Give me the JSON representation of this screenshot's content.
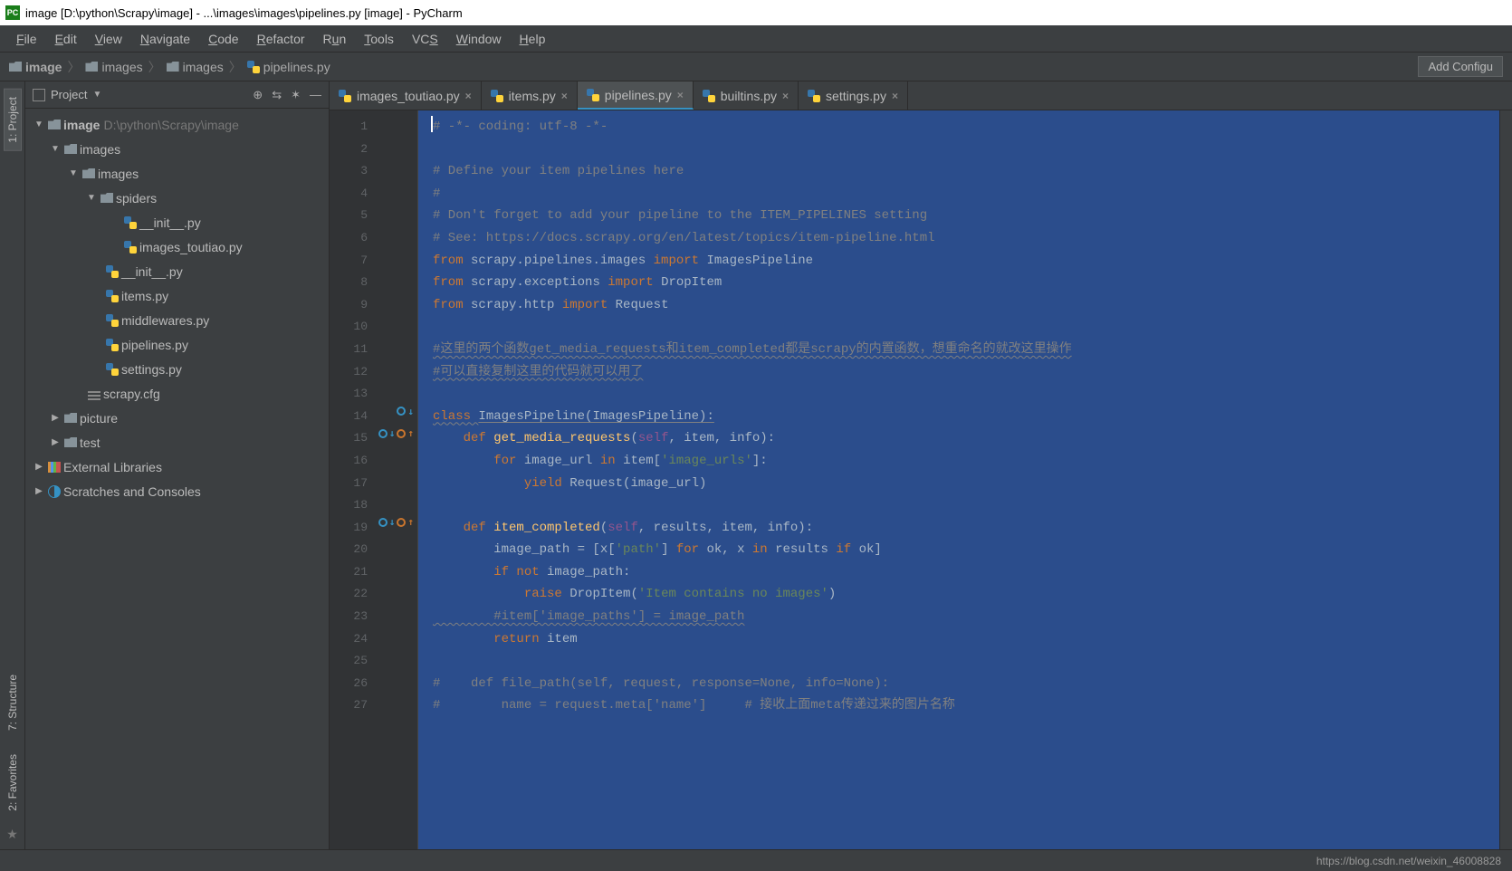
{
  "titlebar": {
    "text": "image [D:\\python\\Scrapy\\image] - ...\\images\\images\\pipelines.py [image] - PyCharm"
  },
  "menu": [
    "File",
    "Edit",
    "View",
    "Navigate",
    "Code",
    "Refactor",
    "Run",
    "Tools",
    "VCS",
    "Window",
    "Help"
  ],
  "breadcrumb": {
    "items": [
      "image",
      "images",
      "images",
      "pipelines.py"
    ]
  },
  "toolbar": {
    "add_config": "Add Configu"
  },
  "left_tabs": {
    "project": "1: Project",
    "structure": "7: Structure",
    "favorites": "2: Favorites"
  },
  "project_header": {
    "title": "Project"
  },
  "tree": {
    "root": {
      "name": "image",
      "path": "D:\\python\\Scrapy\\image"
    },
    "images1": "images",
    "images2": "images",
    "spiders": "spiders",
    "spiders_init": "__init__.py",
    "spiders_toutiao": "images_toutiao.py",
    "init": "__init__.py",
    "items": "items.py",
    "middlewares": "middlewares.py",
    "pipelines": "pipelines.py",
    "settings": "settings.py",
    "scrapycfg": "scrapy.cfg",
    "picture": "picture",
    "test": "test",
    "external": "External Libraries",
    "scratches": "Scratches and Consoles"
  },
  "tabs": [
    {
      "label": "images_toutiao.py",
      "active": false
    },
    {
      "label": "items.py",
      "active": false
    },
    {
      "label": "pipelines.py",
      "active": true
    },
    {
      "label": "builtins.py",
      "active": false
    },
    {
      "label": "settings.py",
      "active": false
    }
  ],
  "code": {
    "l1": "# -*- coding: utf-8 -*-",
    "l2": "",
    "l3": "# Define your item pipelines here",
    "l4": "#",
    "l5": "# Don't forget to add your pipeline to the ITEM_PIPELINES setting",
    "l6": "# See: https://docs.scrapy.org/en/latest/topics/item-pipeline.html",
    "l7a": "from ",
    "l7b": "scrapy.pipelines.images ",
    "l7c": "import ",
    "l7d": "ImagesPipeline",
    "l8a": "from ",
    "l8b": "scrapy.exceptions ",
    "l8c": "import ",
    "l8d": "DropItem",
    "l9a": "from ",
    "l9b": "scrapy.http ",
    "l9c": "import ",
    "l9d": "Request",
    "l11": "#这里的两个函数get_media_requests和item_completed都是scrapy的内置函数，想重命名的就改这里操作",
    "l12": "#可以直接复制这里的代码就可以用了",
    "l14a": "class ",
    "l14b": "ImagesPipeline(ImagesPipeline):",
    "l15a": "    def ",
    "l15b": "get_media_requests",
    "l15c": "(",
    "l15d": "self",
    "l15e": ", item, info):",
    "l16a": "        for ",
    "l16b": "image_url ",
    "l16c": "in ",
    "l16d": "item[",
    "l16e": "'image_urls'",
    "l16f": "]:",
    "l17a": "            yield ",
    "l17b": "Request(image_url)",
    "l19a": "    def ",
    "l19b": "item_completed",
    "l19c": "(",
    "l19d": "self",
    "l19e": ", results, item, info):",
    "l20a": "        image_path = [x[",
    "l20b": "'path'",
    "l20c": "] ",
    "l20d": "for ",
    "l20e": "ok, x ",
    "l20f": "in ",
    "l20g": "results ",
    "l20h": "if ",
    "l20i": "ok]",
    "l21a": "        if not ",
    "l21b": "image_path:",
    "l22a": "            raise ",
    "l22b": "DropItem(",
    "l22c": "'Item contains no images'",
    "l22d": ")",
    "l23": "        #item['image_paths'] = image_path",
    "l24a": "        return ",
    "l24b": "item",
    "l26": "#    def file_path(self, request, response=None, info=None):",
    "l27": "#        name = request.meta['name']     # 接收上面meta传递过来的图片名称"
  },
  "line_numbers": [
    "1",
    "2",
    "3",
    "4",
    "5",
    "6",
    "7",
    "8",
    "9",
    "10",
    "11",
    "12",
    "13",
    "14",
    "15",
    "16",
    "17",
    "18",
    "19",
    "20",
    "21",
    "22",
    "23",
    "24",
    "25",
    "26",
    "27"
  ],
  "status": {
    "watermark": "https://blog.csdn.net/weixin_46008828"
  }
}
